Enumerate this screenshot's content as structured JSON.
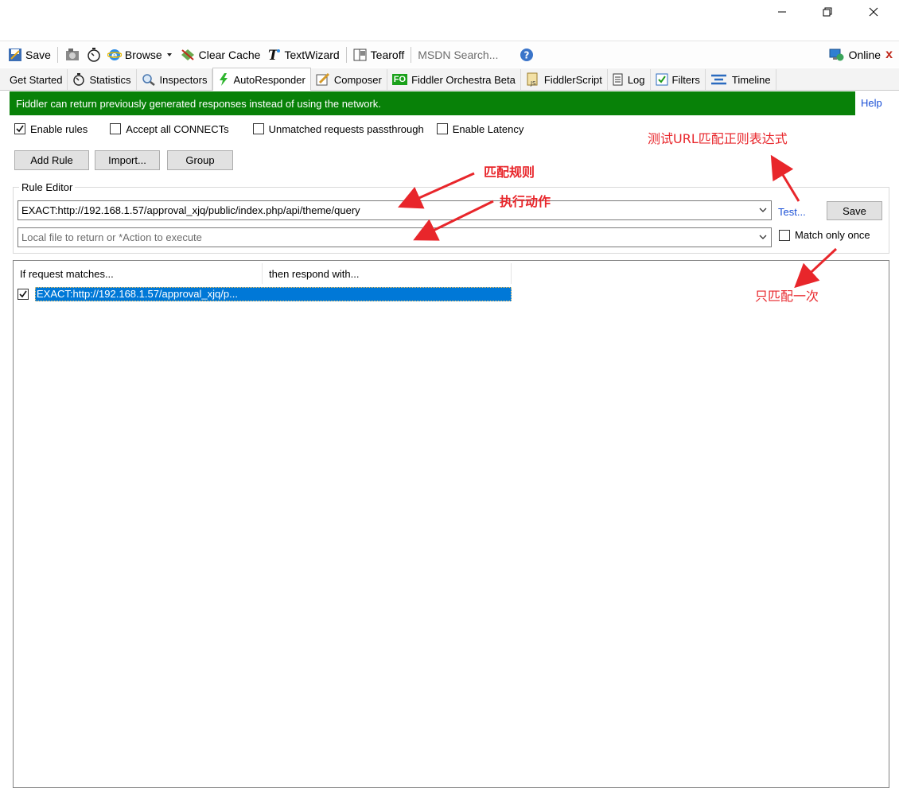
{
  "toolbar": {
    "save": "Save",
    "browse": "Browse",
    "clear_cache": "Clear Cache",
    "text_wizard": "TextWizard",
    "tearoff": "Tearoff",
    "msdn_search": "MSDN Search...",
    "online": "Online",
    "close_mark": "x"
  },
  "tabs": [
    {
      "label": "Get Started",
      "icon": ""
    },
    {
      "label": "Statistics",
      "icon": "stopwatch-icon"
    },
    {
      "label": "Inspectors",
      "icon": "magnifier-icon"
    },
    {
      "label": "AutoResponder",
      "icon": "lightning-icon",
      "active": true
    },
    {
      "label": "Composer",
      "icon": "pencil-icon"
    },
    {
      "label": "Fiddler Orchestra Beta",
      "icon": "fo-icon",
      "icon_text": "FO"
    },
    {
      "label": "FiddlerScript",
      "icon": "script-icon"
    },
    {
      "label": "Log",
      "icon": "log-icon"
    },
    {
      "label": "Filters",
      "icon": "checkbox-icon"
    },
    {
      "label": "Timeline",
      "icon": "timeline-icon"
    }
  ],
  "banner": {
    "text": "Fiddler can return previously generated responses instead of using the network.",
    "help": "Help"
  },
  "options": {
    "enable_rules": {
      "label": "Enable rules",
      "checked": true
    },
    "accept_connects": {
      "label": "Accept all CONNECTs",
      "checked": false
    },
    "unmatched_passthrough": {
      "label": "Unmatched requests passthrough",
      "checked": false
    },
    "enable_latency": {
      "label": "Enable Latency",
      "checked": false
    }
  },
  "buttons": {
    "add_rule": "Add Rule",
    "import": "Import...",
    "group": "Group"
  },
  "rule_editor": {
    "label": "Rule Editor",
    "match_value": "EXACT:http://192.168.1.57/approval_xjq/public/index.php/api/theme/query",
    "action_placeholder": "Local file to return or *Action to execute",
    "test": "Test...",
    "save": "Save",
    "match_only_once": "Match only once"
  },
  "rules_list": {
    "columns": [
      "If request matches...",
      "then respond with..."
    ],
    "rows": [
      {
        "match": "EXACT:http://192.168.1.57/approval_xjq/p...",
        "respond": "",
        "checked": true,
        "selected": true
      }
    ]
  },
  "annotations": {
    "test_regex": "测试URL匹配正则表达式",
    "match_rule": "匹配规则",
    "execute_action": "执行动作",
    "match_once": "只匹配一次"
  },
  "colors": {
    "banner_green": "#088108",
    "selection_blue": "#0078d7",
    "link_blue": "#1a4fd6",
    "annotation_red": "#e8262b"
  }
}
